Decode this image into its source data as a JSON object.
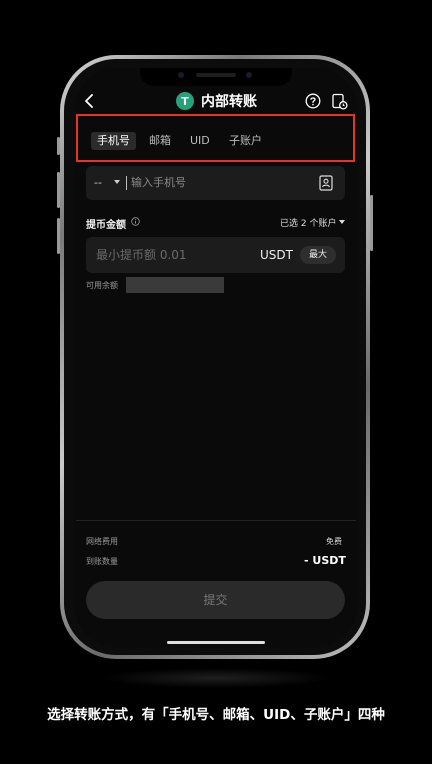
{
  "header": {
    "title": "内部转账",
    "logo_letter": "T",
    "back_icon": "chevron-left-icon",
    "help_icon": "question-circle-icon",
    "history_icon": "history-icon"
  },
  "tabs": [
    {
      "label": "手机号",
      "active": true
    },
    {
      "label": "邮箱",
      "active": false
    },
    {
      "label": "UID",
      "active": false
    },
    {
      "label": "子账户",
      "active": false
    }
  ],
  "phone_input": {
    "country_code": "--",
    "placeholder": "输入手机号",
    "contact_icon": "contact-book-icon"
  },
  "amount": {
    "label": "提币金额",
    "account_selector": "已选 2 个账户",
    "placeholder": "最小提币额 0.01",
    "unit": "USDT",
    "max_label": "最大",
    "available_label": "可用余额"
  },
  "summary": {
    "fee_label": "网络费用",
    "fee_value": "免费",
    "receive_label": "到账数量",
    "receive_value": "- USDT"
  },
  "submit_label": "提交",
  "caption": "选择转账方式，有「手机号、邮箱、UID、子账户」四种",
  "colors": {
    "highlight": "#e8341c",
    "tether": "#26a17b",
    "background": "#0a0a0a"
  }
}
